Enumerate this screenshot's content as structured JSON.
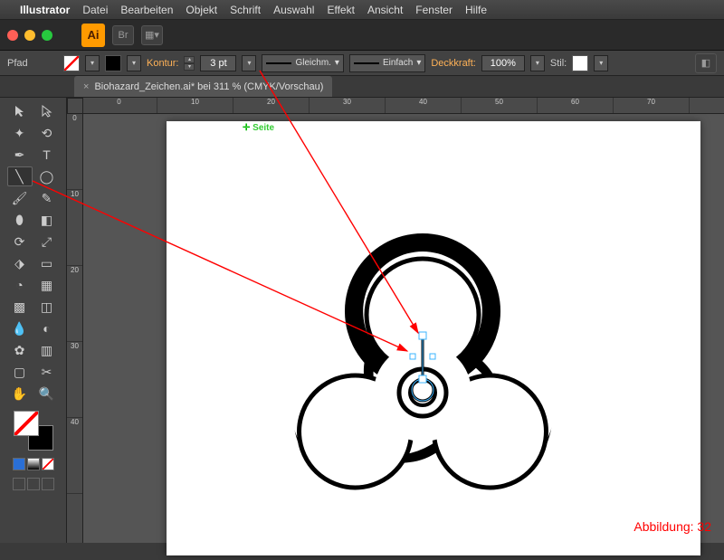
{
  "menubar": {
    "app": "Illustrator",
    "items": [
      "Datei",
      "Bearbeiten",
      "Objekt",
      "Schrift",
      "Auswahl",
      "Effekt",
      "Ansicht",
      "Fenster",
      "Hilfe"
    ]
  },
  "header": {
    "badge": "Ai",
    "br": "Br",
    "layout": "☷"
  },
  "controlbar": {
    "mode": "Pfad",
    "kontur_label": "Kontur:",
    "stroke_value": "3 pt",
    "brush_mode": "Gleichm.",
    "profile_mode": "Einfach",
    "opacity_label": "Deckkraft:",
    "opacity_value": "100%",
    "stil_label": "Stil:"
  },
  "document": {
    "tab": "Biohazard_Zeichen.ai* bei 311 % (CMYK/Vorschau)"
  },
  "rulers": {
    "h": [
      "0",
      "10",
      "20",
      "30",
      "40",
      "50",
      "60",
      "70"
    ],
    "v": [
      "0",
      "10",
      "20",
      "30",
      "40"
    ]
  },
  "canvas": {
    "label": "Seite"
  },
  "annotation": {
    "figure_label": "Abbildung:",
    "figure_num": "32"
  }
}
